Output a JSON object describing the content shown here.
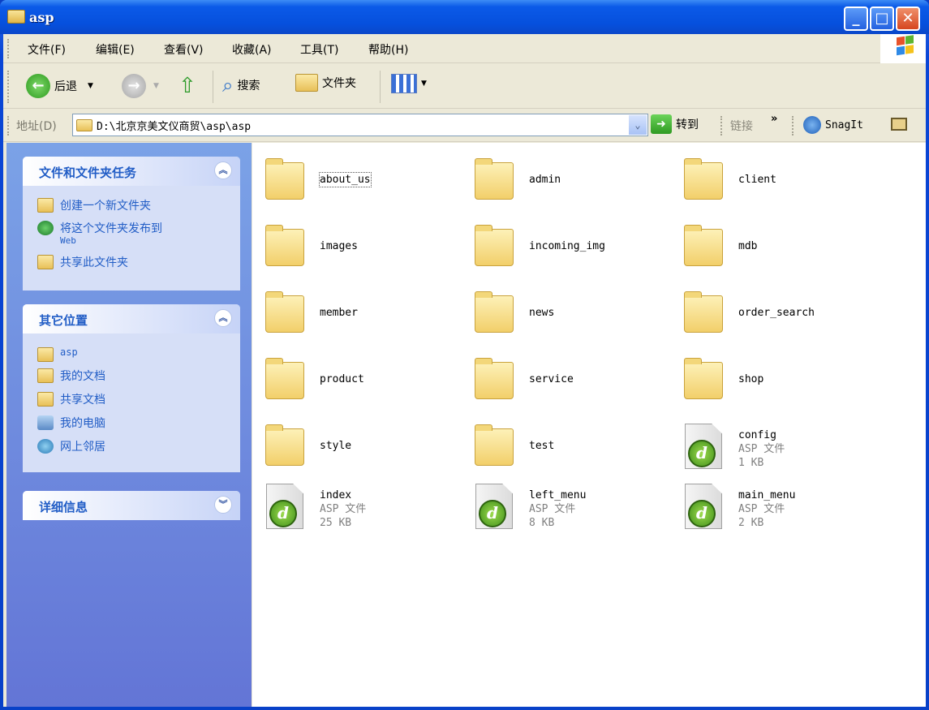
{
  "window": {
    "title": "asp"
  },
  "menu": [
    "文件(F)",
    "编辑(E)",
    "查看(V)",
    "收藏(A)",
    "工具(T)",
    "帮助(H)"
  ],
  "toolbar": {
    "back": "后退",
    "search": "搜索",
    "folders": "文件夹"
  },
  "address": {
    "label": "地址(D)",
    "value": "D:\\北京京美文仪商贸\\asp\\asp",
    "go": "转到",
    "links": "链接",
    "more": "»",
    "snagit": "SnagIt"
  },
  "left": {
    "tasks": {
      "title": "文件和文件夹任务",
      "items": [
        "创建一个新文件夹",
        "将这个文件夹发布到",
        "共享此文件夹"
      ],
      "web": "Web"
    },
    "places": {
      "title": "其它位置",
      "items": [
        "asp",
        "我的文档",
        "共享文档",
        "我的电脑",
        "网上邻居"
      ]
    },
    "details": {
      "title": "详细信息"
    }
  },
  "files": [
    {
      "name": "about_us",
      "type": "folder"
    },
    {
      "name": "admin",
      "type": "folder"
    },
    {
      "name": "client",
      "type": "folder"
    },
    {
      "name": "images",
      "type": "folder"
    },
    {
      "name": "incoming_img",
      "type": "folder"
    },
    {
      "name": "mdb",
      "type": "folder"
    },
    {
      "name": "member",
      "type": "folder"
    },
    {
      "name": "news",
      "type": "folder"
    },
    {
      "name": "order_search",
      "type": "folder"
    },
    {
      "name": "product",
      "type": "folder"
    },
    {
      "name": "service",
      "type": "folder"
    },
    {
      "name": "shop",
      "type": "folder"
    },
    {
      "name": "style",
      "type": "folder"
    },
    {
      "name": "test",
      "type": "folder"
    },
    {
      "name": "config",
      "type": "asp",
      "kind": "ASP 文件",
      "size": "1 KB"
    },
    {
      "name": "index",
      "type": "asp",
      "kind": "ASP 文件",
      "size": "25 KB"
    },
    {
      "name": "left_menu",
      "type": "asp",
      "kind": "ASP 文件",
      "size": "8 KB"
    },
    {
      "name": "main_menu",
      "type": "asp",
      "kind": "ASP 文件",
      "size": "2 KB"
    }
  ]
}
